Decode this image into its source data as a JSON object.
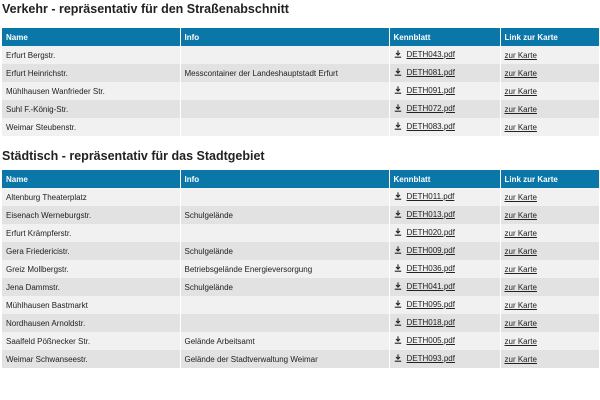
{
  "sections": [
    {
      "title": "Verkehr - repräsentativ für den Straßenabschnitt",
      "headers": [
        "Name",
        "Info",
        "Kennblatt",
        "Link zur Karte"
      ],
      "rows": [
        {
          "name": "Erfurt Bergstr.",
          "info": "",
          "pdf": "DETH043.pdf",
          "link": "zur Karte"
        },
        {
          "name": "Erfurt Heinrichstr.",
          "info": "Messcontainer der Landeshauptstadt Erfurt",
          "pdf": "DETH081.pdf",
          "link": "zur Karte"
        },
        {
          "name": "Mühlhausen Wanfrieder Str.",
          "info": "",
          "pdf": "DETH091.pdf",
          "link": "zur Karte"
        },
        {
          "name": "Suhl F.-König-Str.",
          "info": "",
          "pdf": "DETH072.pdf",
          "link": "zur Karte"
        },
        {
          "name": "Weimar Steubenstr.",
          "info": "",
          "pdf": "DETH083.pdf",
          "link": "zur Karte"
        }
      ]
    },
    {
      "title": "Städtisch - repräsentativ für das Stadtgebiet",
      "headers": [
        "Name",
        "Info",
        "Kennblatt",
        "Link zur Karte"
      ],
      "rows": [
        {
          "name": "Altenburg Theaterplatz",
          "info": "",
          "pdf": "DETH011.pdf",
          "link": "zur Karte"
        },
        {
          "name": "Eisenach Werneburgstr.",
          "info": "Schulgelände",
          "pdf": "DETH013.pdf",
          "link": "zur Karte"
        },
        {
          "name": "Erfurt Krämpferstr.",
          "info": "",
          "pdf": "DETH020.pdf",
          "link": "zur Karte"
        },
        {
          "name": "Gera Friedericistr.",
          "info": "Schulgelände",
          "pdf": "DETH009.pdf",
          "link": "zur Karte"
        },
        {
          "name": "Greiz Mollbergstr.",
          "info": "Betriebsgelände Energieversorgung",
          "pdf": "DETH036.pdf",
          "link": "zur Karte"
        },
        {
          "name": "Jena Dammstr.",
          "info": "Schulgelände",
          "pdf": "DETH041.pdf",
          "link": "zur Karte"
        },
        {
          "name": "Mühlhausen Bastmarkt",
          "info": "",
          "pdf": "DETH095.pdf",
          "link": "zur Karte"
        },
        {
          "name": "Nordhausen Arnoldstr.",
          "info": "",
          "pdf": "DETH018.pdf",
          "link": "zur Karte"
        },
        {
          "name": "Saalfeld Pößnecker Str.",
          "info": "Gelände Arbeitsamt",
          "pdf": "DETH005.pdf",
          "link": "zur Karte"
        },
        {
          "name": "Weimar Schwanseestr.",
          "info": "Gelände der Stadtverwaltung Weimar",
          "pdf": "DETH093.pdf",
          "link": "zur Karte"
        }
      ]
    }
  ],
  "colors": {
    "header_bg": "#0b77a8",
    "row_odd": "#f1f1f1",
    "row_even": "#e2e2e2"
  },
  "icons": {
    "pdf": "download-icon"
  }
}
